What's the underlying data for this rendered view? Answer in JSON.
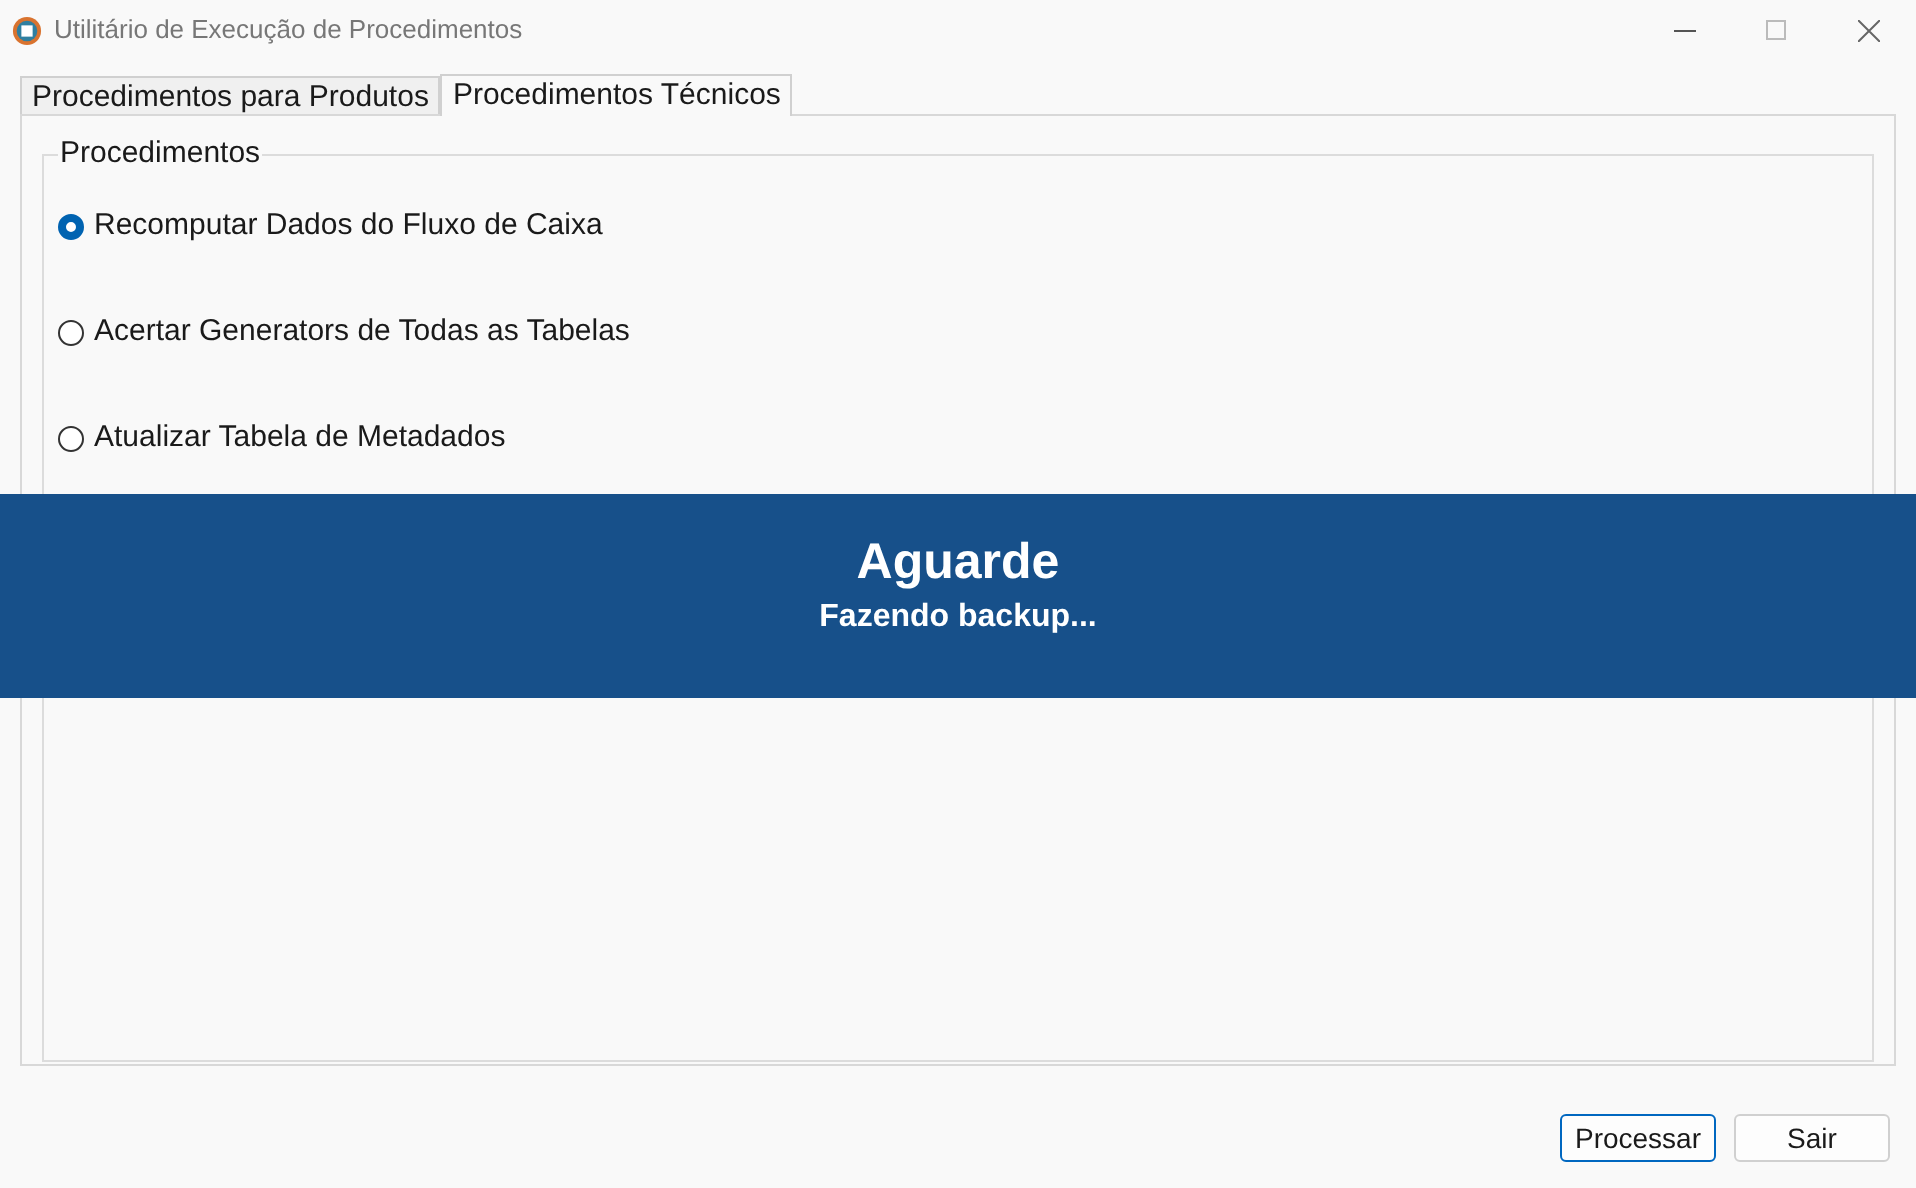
{
  "window": {
    "title": "Utilitário de Execução de Procedimentos"
  },
  "tabs": [
    {
      "label": "Procedimentos para Produtos",
      "selected": false
    },
    {
      "label": "Procedimentos Técnicos",
      "selected": true
    }
  ],
  "group": {
    "title": "Procedimentos"
  },
  "options": [
    {
      "label": "Recomputar Dados do Fluxo de Caixa",
      "selected": true
    },
    {
      "label": "Acertar Generators de Todas as Tabelas",
      "selected": false
    },
    {
      "label": "Atualizar Tabela de Metadados",
      "selected": false
    }
  ],
  "overlay": {
    "title": "Aguarde",
    "message": "Fazendo backup..."
  },
  "buttons": [
    {
      "label": "Processar",
      "selected": true
    },
    {
      "label": "Sair",
      "selected": false
    }
  ]
}
